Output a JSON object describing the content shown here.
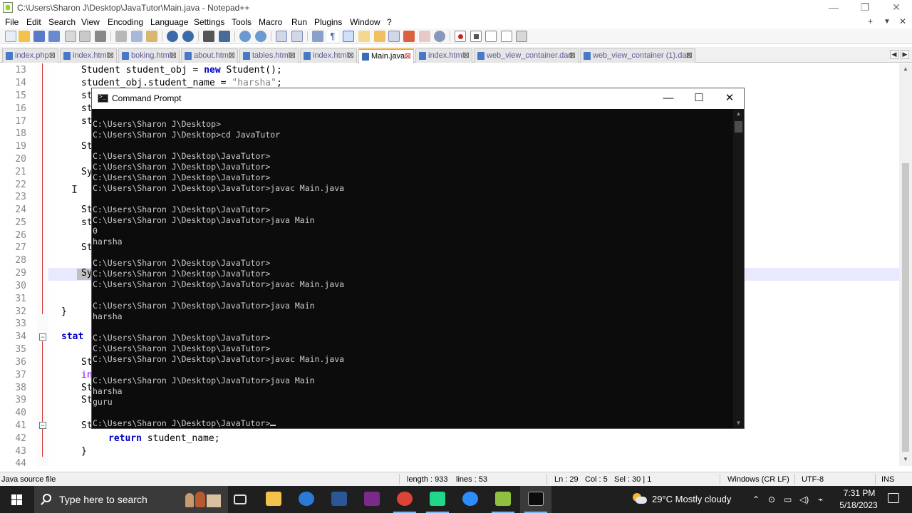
{
  "window": {
    "title": "C:\\Users\\Sharon J\\Desktop\\JavaTutor\\Main.java - Notepad++",
    "min_icon": "minimize-icon",
    "max_icon": "restore-icon",
    "close_icon": "close-icon"
  },
  "menu": {
    "items": [
      "File",
      "Edit",
      "Search",
      "View",
      "Encoding",
      "Language",
      "Settings",
      "Tools",
      "Macro",
      "Run",
      "Plugins",
      "Window",
      "?"
    ],
    "plus": "+",
    "dropdown": "▼",
    "close": "✕"
  },
  "tabs": [
    {
      "label": "index.php",
      "active": false
    },
    {
      "label": "index.html",
      "active": false
    },
    {
      "label": "boking.html",
      "active": false
    },
    {
      "label": "about.html",
      "active": false
    },
    {
      "label": "tables.html",
      "active": false
    },
    {
      "label": "index.html",
      "active": false
    },
    {
      "label": "Main.java",
      "active": true
    },
    {
      "label": "index.html",
      "active": false
    },
    {
      "label": "web_view_container.dart",
      "active": false
    },
    {
      "label": "web_view_container (1).dart",
      "active": false
    }
  ],
  "editor": {
    "line_numbers": [
      "13",
      "14",
      "15",
      "16",
      "17",
      "18",
      "19",
      "20",
      "21",
      "22",
      "23",
      "24",
      "25",
      "26",
      "27",
      "28",
      "29",
      "30",
      "31",
      "32",
      "33",
      "34",
      "35",
      "36",
      "37",
      "38",
      "39",
      "40",
      "41",
      "42",
      "43",
      "44"
    ],
    "lines": {
      "l13_type": "Student student_obj = ",
      "l13_kw": "new",
      "l13_rest": " Student();",
      "l14_a": "student_obj.student_name = ",
      "l14_str": "\"harsha\"",
      "l14_b": ";",
      "l15": "st",
      "l16": "st",
      "l17": "st",
      "l19": "St",
      "l21": "Sy",
      "l24": "St",
      "l25": "st",
      "l27": "St",
      "l29": "Sy",
      "l32": "}",
      "l34_kw": "stat",
      "l36": "St",
      "l37": "in",
      "l38": "St",
      "l39": "St",
      "l41": "St",
      "l42_kw": "return",
      "l42_rest": " student_name;",
      "l43": "}"
    }
  },
  "cmd": {
    "title": "Command Prompt",
    "min": "—",
    "max": "☐",
    "close": "✕",
    "lines": [
      "",
      "C:\\Users\\Sharon J\\Desktop>",
      "C:\\Users\\Sharon J\\Desktop>cd JavaTutor",
      "",
      "C:\\Users\\Sharon J\\Desktop\\JavaTutor>",
      "C:\\Users\\Sharon J\\Desktop\\JavaTutor>",
      "C:\\Users\\Sharon J\\Desktop\\JavaTutor>",
      "C:\\Users\\Sharon J\\Desktop\\JavaTutor>javac Main.java",
      "",
      "C:\\Users\\Sharon J\\Desktop\\JavaTutor>",
      "C:\\Users\\Sharon J\\Desktop\\JavaTutor>java Main",
      "0",
      "harsha",
      "",
      "C:\\Users\\Sharon J\\Desktop\\JavaTutor>",
      "C:\\Users\\Sharon J\\Desktop\\JavaTutor>",
      "C:\\Users\\Sharon J\\Desktop\\JavaTutor>javac Main.java",
      "",
      "C:\\Users\\Sharon J\\Desktop\\JavaTutor>java Main",
      "harsha",
      "",
      "C:\\Users\\Sharon J\\Desktop\\JavaTutor>",
      "C:\\Users\\Sharon J\\Desktop\\JavaTutor>",
      "C:\\Users\\Sharon J\\Desktop\\JavaTutor>javac Main.java",
      "",
      "C:\\Users\\Sharon J\\Desktop\\JavaTutor>java Main",
      "harsha",
      "guru",
      "",
      "C:\\Users\\Sharon J\\Desktop\\JavaTutor>"
    ]
  },
  "status": {
    "file_type": "Java source file",
    "length": "length : 933",
    "lines": "lines : 53",
    "ln": "Ln : 29",
    "col": "Col : 5",
    "sel": "Sel : 30 | 1",
    "eol": "Windows (CR LF)",
    "encoding": "UTF-8",
    "mode": "INS"
  },
  "taskbar": {
    "search_placeholder": "Type here to search",
    "weather": "29°C  Mostly cloudy",
    "time": "7:31 PM",
    "date": "5/18/2023",
    "apps": [
      "task-view-icon",
      "file-explorer-icon",
      "edge-icon",
      "word-icon",
      "pen-tool-icon",
      "chrome-icon",
      "pycharm-icon",
      "zoom-icon",
      "notepadpp-icon",
      "cmd-icon"
    ],
    "colors": {
      "accent": "#7ab7f0",
      "taskbar": "#1f1f1f",
      "search": "#3a3a3a"
    }
  }
}
